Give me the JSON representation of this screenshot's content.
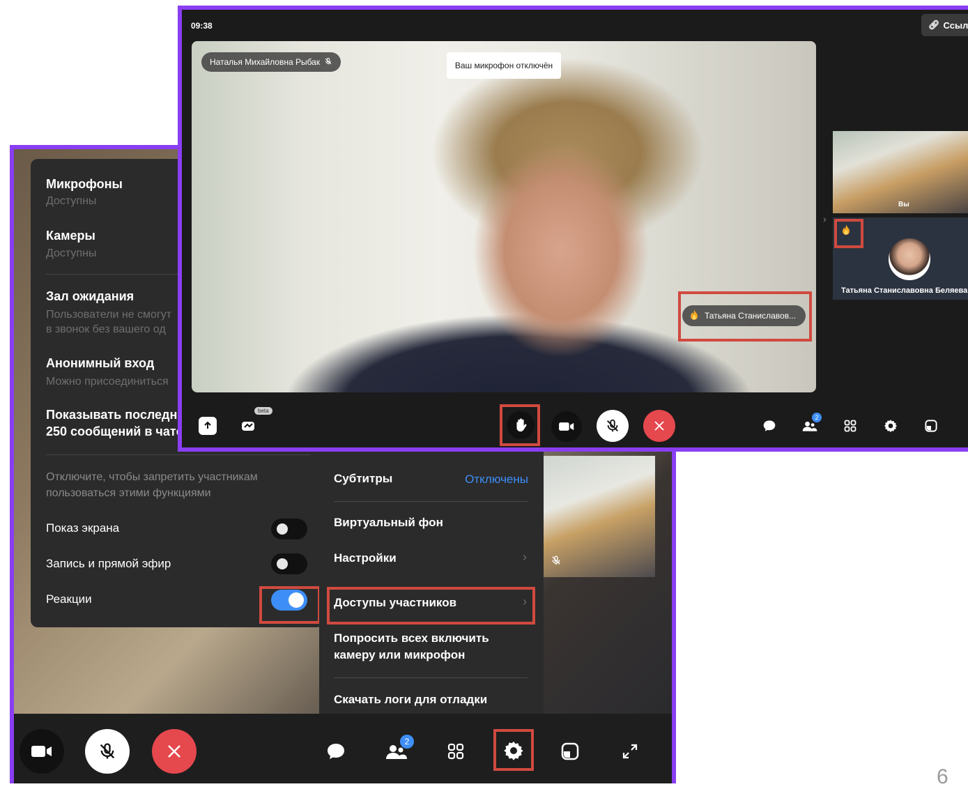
{
  "front": {
    "clock": "09:38",
    "link_button": "Ссылк",
    "speaker_name": "Наталья Михайловна Рыбак",
    "mic_off_toast": "Ваш микрофон отключён",
    "hand_chip_name": "Татьяна Станиславов...",
    "self_label": "Вы",
    "participant_name": "Татьяна Станиславовна Беляева",
    "beta_badge": "beta",
    "participants_count": "2"
  },
  "permissions": {
    "items": [
      {
        "title": "Микрофоны",
        "subtitle": "Доступны"
      },
      {
        "title": "Камеры",
        "subtitle": "Доступны"
      }
    ],
    "waiting_room": {
      "title": "Зал ожидания",
      "line1": "Пользователи не смогут",
      "line2": "в звонок без вашего од"
    },
    "anonymous": {
      "title": "Анонимный вход",
      "subtitle": "Можно присоединиться"
    },
    "history": {
      "line1": "Показывать последни",
      "line2": "250 сообщений в чате"
    },
    "hint_line1": "Отключите, чтобы запретить участникам",
    "hint_line2": "пользоваться этими функциями",
    "toggles": [
      {
        "label": "Показ экрана",
        "on": false
      },
      {
        "label": "Запись и прямой эфир",
        "on": false
      },
      {
        "label": "Реакции",
        "on": true
      }
    ]
  },
  "settings_menu": {
    "subtitles_label": "Субтитры",
    "subtitles_value": "Отключены",
    "virtual_bg": "Виртуальный фон",
    "settings": "Настройки",
    "participant_access": "Доступы участников",
    "ask_all_line1": "Попросить всех включить",
    "ask_all_line2": "камеру или микрофон",
    "download_logs": "Скачать логи для отладки"
  },
  "back_toolbar": {
    "participants_count": "2"
  },
  "page_number": "6",
  "colors": {
    "accent_border": "#8a3ef2",
    "highlight": "#d04a3f",
    "end_call": "#e5484d",
    "toggle_on": "#3e8ef7",
    "link_blue": "#3e8ef7"
  }
}
